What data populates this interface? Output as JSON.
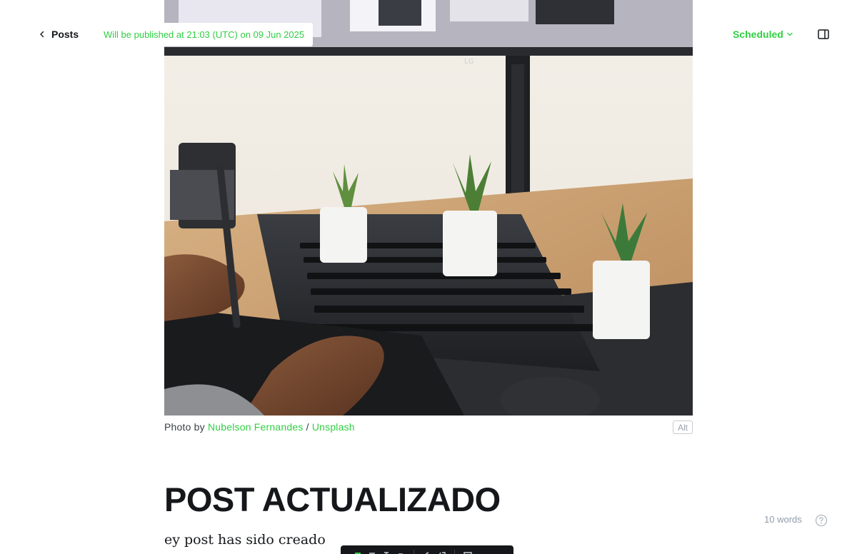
{
  "header": {
    "back_label": "Posts",
    "publish_note": "Will be published at 21:03 (UTC) on 09 Jun 2025",
    "status_label": "Scheduled"
  },
  "feature_image": {
    "caption_prefix": "Photo by",
    "photographer": "Nubelson Fernandes",
    "separator": "/",
    "source": "Unsplash",
    "alt_button": "Alt"
  },
  "post": {
    "title": "POST ACTUALIZADO",
    "body": "ey post has sido creado"
  },
  "footer": {
    "word_count": "10 words"
  },
  "colors": {
    "accent": "#30cf43",
    "text": "#15171a",
    "muted": "#8e9cac"
  },
  "icons": {
    "back": "chevron-left-icon",
    "status": "chevron-down-icon",
    "sidebar": "sidebar-toggle-icon",
    "help": "help-circle-icon"
  }
}
